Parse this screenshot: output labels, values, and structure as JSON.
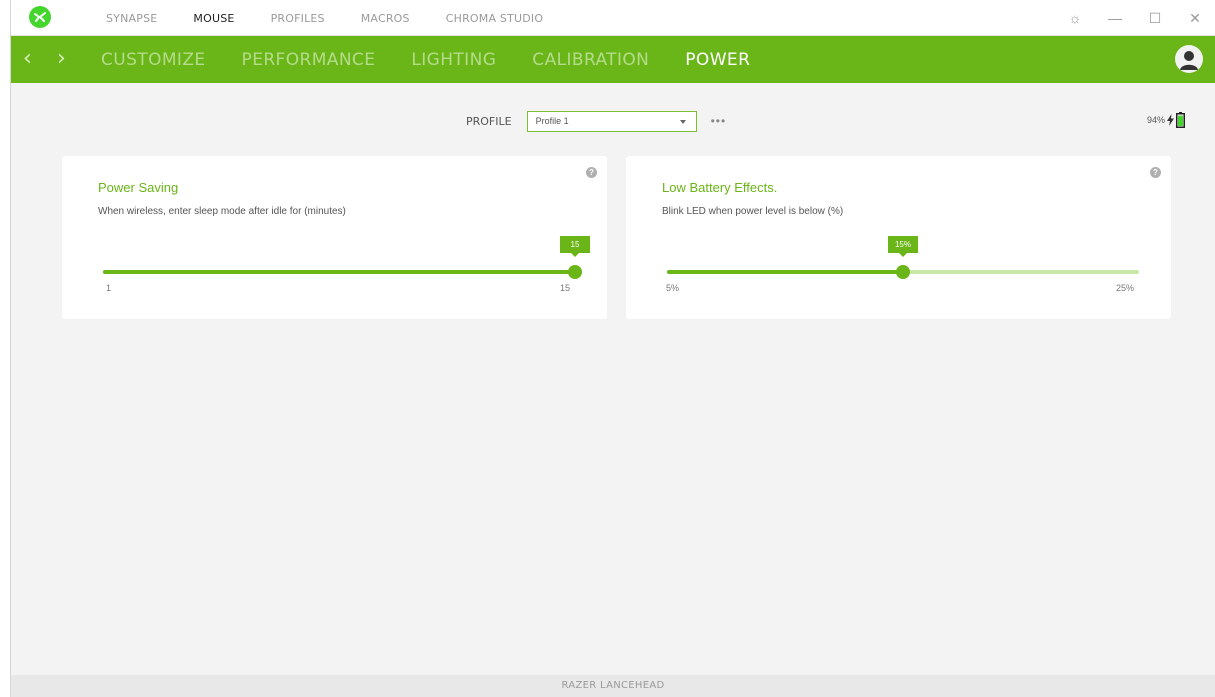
{
  "topnav": {
    "items": [
      "SYNAPSE",
      "MOUSE",
      "PROFILES",
      "MACROS",
      "CHROMA STUDIO"
    ],
    "active": "MOUSE"
  },
  "window_controls": {
    "settings": "☼",
    "minimize": "—",
    "maximize": "☐",
    "close": "✕"
  },
  "subnav": {
    "back": "‹",
    "forward": "›",
    "tabs": [
      "CUSTOMIZE",
      "PERFORMANCE",
      "LIGHTING",
      "CALIBRATION",
      "POWER"
    ],
    "active": "POWER"
  },
  "profile": {
    "label": "PROFILE",
    "selected": "Profile 1",
    "more": "•••"
  },
  "battery": {
    "percent": "94%",
    "level": 0.94
  },
  "power_saving": {
    "title": "Power Saving",
    "description": "When wireless, enter sleep mode after idle for (minutes)",
    "min_label": "1",
    "max_label": "15",
    "value_label": "15",
    "value": 15,
    "min": 1,
    "max": 15
  },
  "low_battery": {
    "title": "Low Battery Effects.",
    "description": "Blink LED when power level is below (%)",
    "min_label": "5%",
    "max_label": "25%",
    "value_label": "15%",
    "value": 15,
    "min": 5,
    "max": 25
  },
  "help_glyph": "?",
  "footer": {
    "device": "RAZER LANCEHEAD"
  },
  "colors": {
    "accent": "#6ab518",
    "accent_light": "#c8e6a6",
    "logo": "#44d62c"
  }
}
